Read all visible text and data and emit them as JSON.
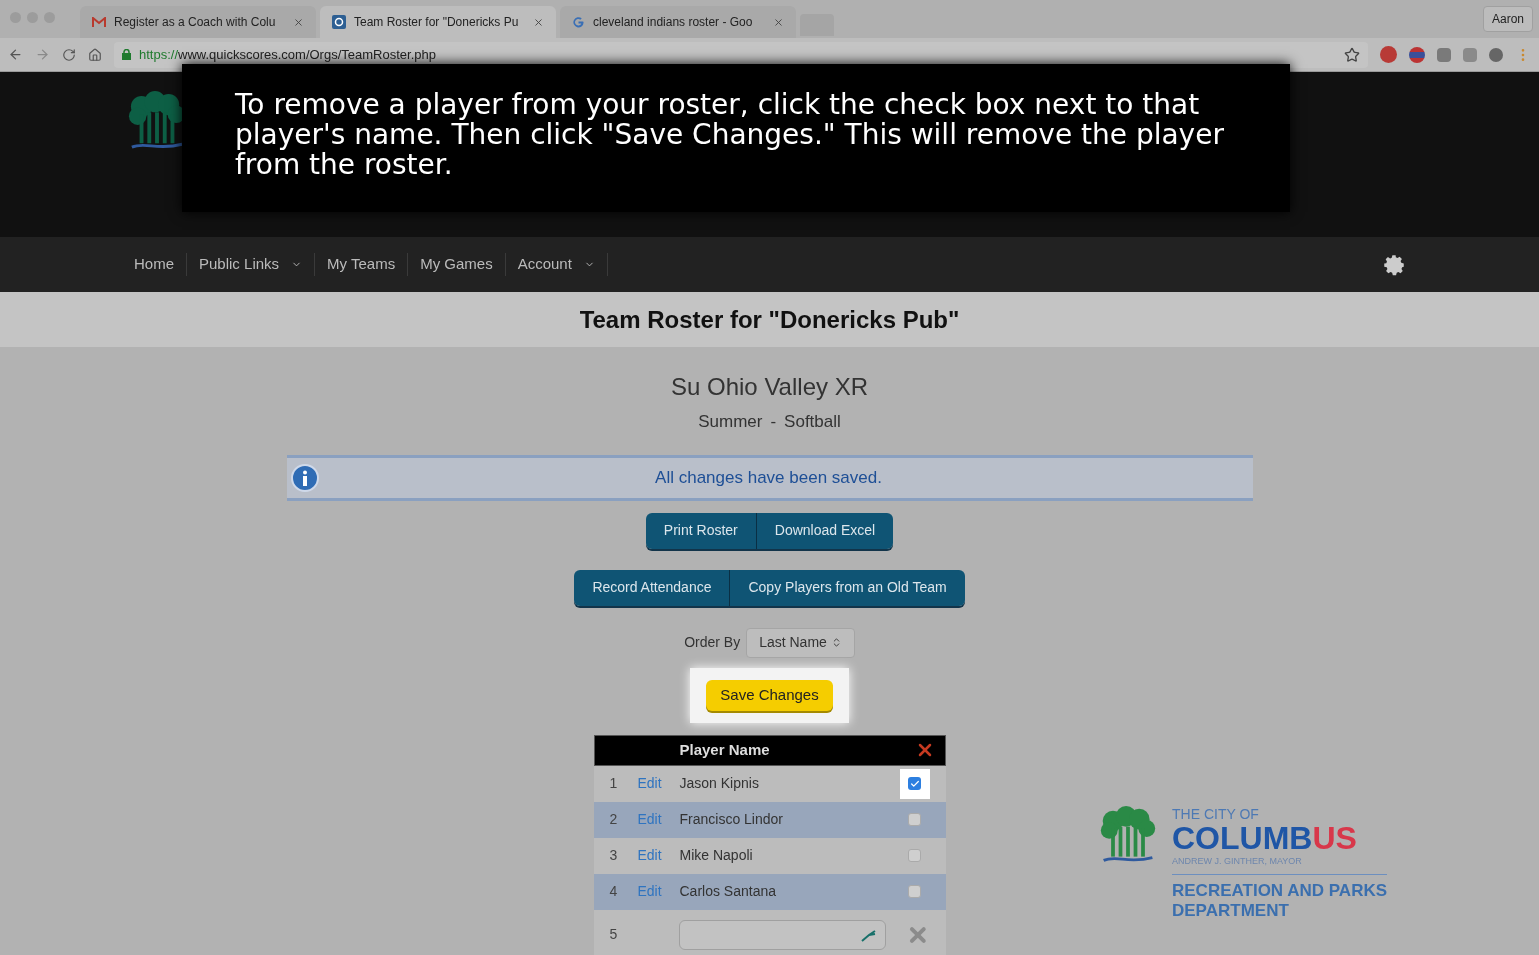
{
  "browser": {
    "tabs": [
      {
        "kind": "mail",
        "title": "Register as a Coach with Colu",
        "selected": false
      },
      {
        "kind": "site",
        "title": "Team Roster for \"Donericks Pu",
        "selected": true
      },
      {
        "kind": "search",
        "title": "cleveland indians roster - Goo",
        "selected": false
      }
    ],
    "profile": "Aaron",
    "url_scheme": "https://",
    "url_rest": "www.quickscores.com/Orgs/TeamRoster.php"
  },
  "tooltip": "To remove a player from your roster, click the check box next to that player's name. Then click \"Save Changes.\" This will remove the player from the roster.",
  "nav": [
    {
      "label": "Home",
      "dropdown": false
    },
    {
      "label": "Public Links",
      "dropdown": true
    },
    {
      "label": "My Teams",
      "dropdown": false
    },
    {
      "label": "My Games",
      "dropdown": false
    },
    {
      "label": "Account",
      "dropdown": true
    }
  ],
  "page_title": "Team Roster for \"Donericks Pub\"",
  "league": "Su Ohio Valley XR",
  "season": "Summer",
  "sport": "Softball",
  "separator": "-",
  "notice": "All changes have been saved.",
  "button_groups": [
    [
      "Print Roster",
      "Download Excel"
    ],
    [
      "Record Attendance",
      "Copy Players from an Old Team"
    ]
  ],
  "order_by": {
    "label": "Order By",
    "value": "Last Name"
  },
  "save_button": "Save Changes",
  "table": {
    "header": "Player Name",
    "rows": [
      {
        "number": "1",
        "edit": "Edit",
        "name": "Jason Kipnis",
        "checked": true
      },
      {
        "number": "2",
        "edit": "Edit",
        "name": "Francisco Lindor",
        "checked": false
      },
      {
        "number": "3",
        "edit": "Edit",
        "name": "Mike Napoli",
        "checked": false
      },
      {
        "number": "4",
        "edit": "Edit",
        "name": "Carlos Santana",
        "checked": false
      }
    ],
    "new_row": {
      "number": "5"
    }
  },
  "footer_logo": {
    "line1": "THE CITY OF",
    "city": "COLUMB",
    "city_accent": "US",
    "mayor": "ANDREW J. GINTHER, MAYOR",
    "dept1": "RECREATION AND PARKS",
    "dept2": "DEPARTMENT"
  }
}
